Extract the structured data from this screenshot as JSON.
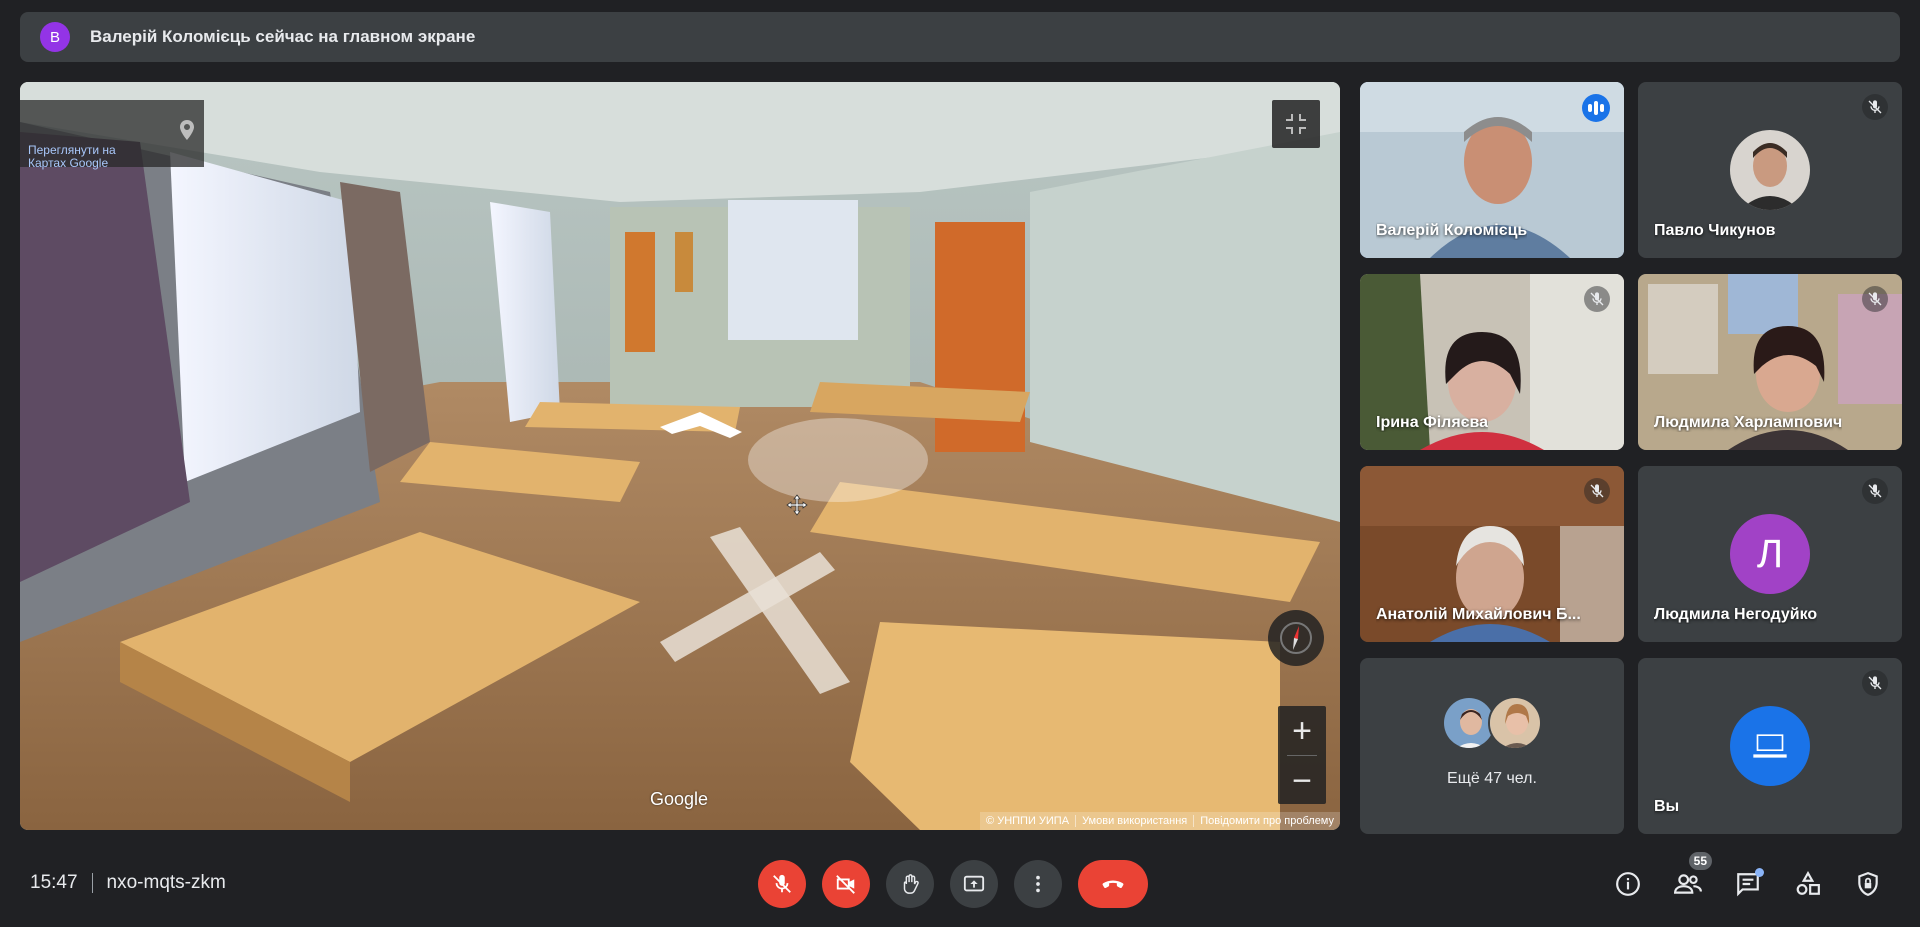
{
  "banner": {
    "avatar_letter": "В",
    "text": "Валерій Коломієць сейчас на главном экране"
  },
  "presentation": {
    "maps_link": "Переглянути на Картах Google",
    "google_logo": "Google",
    "attribution": [
      "© УНППИ УИПА",
      "Умови використання",
      "Повідомити про проблему"
    ],
    "zoom_in": "+",
    "zoom_out": "−"
  },
  "participants": [
    {
      "name": "Валерій Коломієць",
      "speaking": true
    },
    {
      "name": "Павло Чикунов",
      "muted": true
    },
    {
      "name": "Ірина Філяєва",
      "muted": true
    },
    {
      "name": "Людмила Харлампович",
      "muted": true
    },
    {
      "name": "Анатолій Михайлович Б...",
      "muted": true
    },
    {
      "name": "Людмила Негодуйко",
      "muted": true,
      "avatar_letter": "Л",
      "avatar_color": "#a142c6"
    },
    {
      "name": "Вы",
      "muted": true,
      "avatar_color": "#1a73e8"
    }
  ],
  "more_participants": "Ещё 47 чел.",
  "footer": {
    "time": "15:47",
    "meeting_code": "nxo-mqts-zkm",
    "people_count": "55"
  },
  "colors": {
    "accent": "#8ab4f8",
    "danger": "#ea4335",
    "surface": "#3c4043",
    "background": "#202124"
  }
}
